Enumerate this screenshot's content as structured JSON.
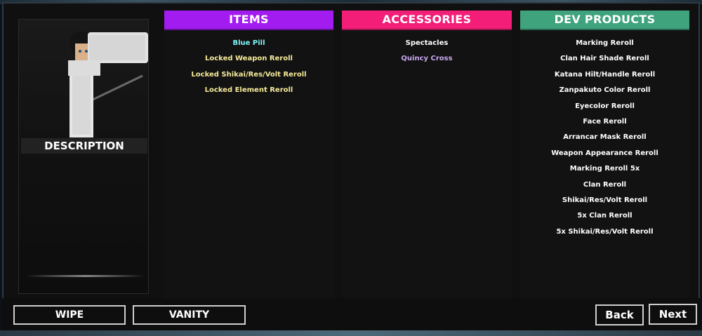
{
  "preview": {
    "description_label": "DESCRIPTION"
  },
  "columns": {
    "items": {
      "header": "ITEMS",
      "header_color": "#a21cf0",
      "entries": [
        {
          "label": "Blue Pill",
          "color": "#7ff3f6"
        },
        {
          "label": "Locked Weapon Reroll",
          "color": "#f6ea9a"
        },
        {
          "label": "Locked Shikai/Res/Volt Reroll",
          "color": "#f6ea9a"
        },
        {
          "label": "Locked Element Reroll",
          "color": "#f6ea9a"
        }
      ]
    },
    "accessories": {
      "header": "ACCESSORIES",
      "header_color": "#f21e78",
      "entries": [
        {
          "label": "Spectacles",
          "color": "#ffffff"
        },
        {
          "label": "Quincy Cross",
          "color": "#c9a8f0"
        }
      ]
    },
    "dev_products": {
      "header": "DEV PRODUCTS",
      "header_color": "#3fa37e",
      "entries": [
        {
          "label": "Marking Reroll",
          "color": "#ffffff"
        },
        {
          "label": "Clan Hair Shade Reroll",
          "color": "#ffffff"
        },
        {
          "label": "Katana Hilt/Handle Reroll",
          "color": "#ffffff"
        },
        {
          "label": "Zanpakuto Color Reroll",
          "color": "#ffffff"
        },
        {
          "label": "Eyecolor Reroll",
          "color": "#ffffff"
        },
        {
          "label": "Face Reroll",
          "color": "#ffffff"
        },
        {
          "label": "Arrancar Mask Reroll",
          "color": "#ffffff"
        },
        {
          "label": "Weapon Appearance Reroll",
          "color": "#ffffff"
        },
        {
          "label": "Marking Reroll 5x",
          "color": "#ffffff"
        },
        {
          "label": "Clan Reroll",
          "color": "#ffffff"
        },
        {
          "label": "Shikai/Res/Volt Reroll",
          "color": "#ffffff"
        },
        {
          "label": "5x Clan Reroll",
          "color": "#ffffff"
        },
        {
          "label": "5x Shikai/Res/Volt Reroll",
          "color": "#ffffff"
        }
      ]
    }
  },
  "buttons": {
    "wipe": "WIPE",
    "vanity": "VANITY",
    "back": "Back",
    "next": "Next"
  }
}
